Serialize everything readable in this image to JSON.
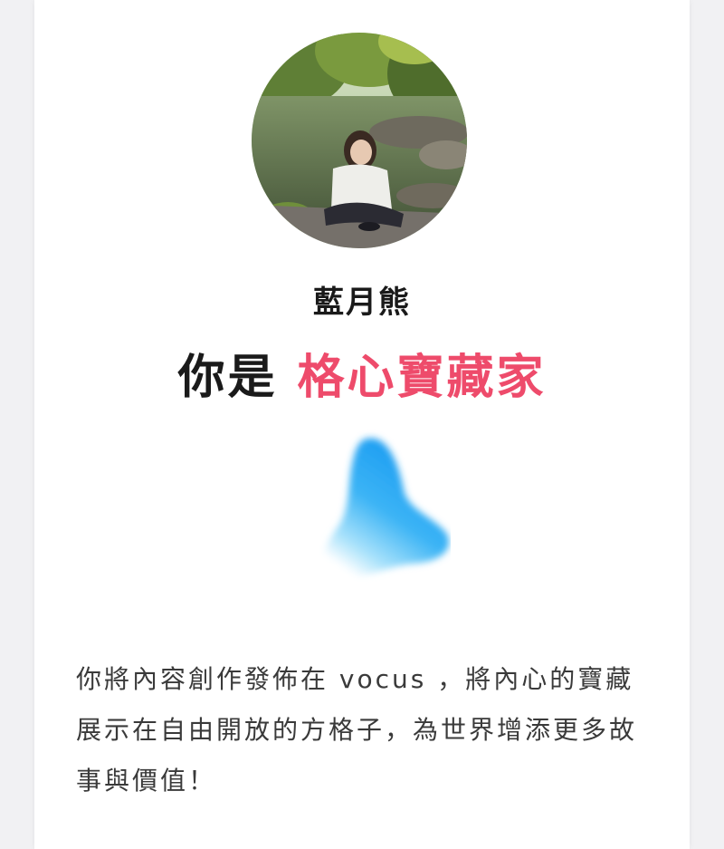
{
  "profile": {
    "name": "藍月熊"
  },
  "result": {
    "prefix": "你是",
    "type_name": "格心寶藏家"
  },
  "description": "你將內容創作發佈在 vocus ，將內心的寶藏展示在自由開放的方格子，為世界增添更多故事與價值！",
  "colors": {
    "accent": "#ee4b6b",
    "blob": "#2aa6f2"
  }
}
